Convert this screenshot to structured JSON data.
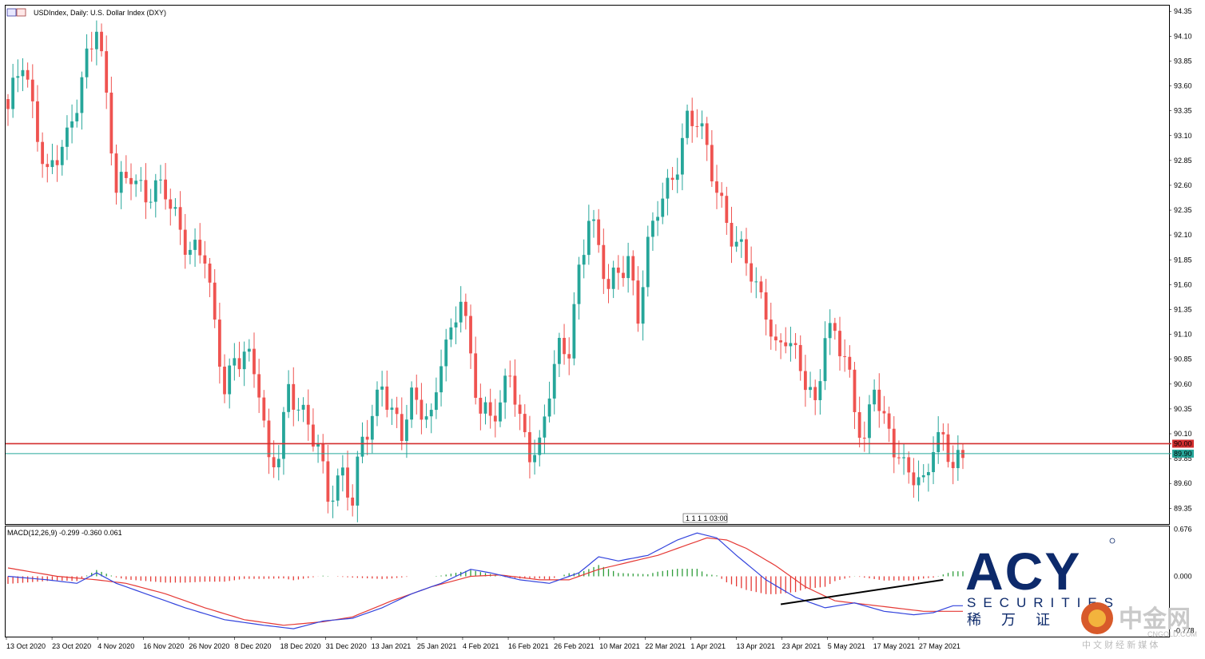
{
  "window": {
    "title": "USDIndex, Daily:  U.S. Dollar Index (DXY)"
  },
  "indicator": {
    "label": "MACD(12,26,9) -0.299 -0.360 0.061"
  },
  "price_tags": {
    "red_line_label": "90.00",
    "cyan_line_label": "89.90"
  },
  "period_separator_label": "1 1 1 1 03:00",
  "brand": {
    "name": "ACY",
    "tagline": "SECURITIES",
    "chinese": "稀 万 证",
    "watermark": "中金网",
    "watermark_url": "CNGOLD.COM",
    "watermark_cn": "中 文 财 经 新 媒 体"
  },
  "colors": {
    "bull": "#26a69a",
    "bear": "#ef5350",
    "red_line": "#d32f2f",
    "cyan_line": "#26a69a",
    "macd_line": "#3344dd",
    "signal_line": "#e53935",
    "hist_up": "#2e9d3a",
    "hist_down": "#e53935",
    "trend_line": "#000000"
  },
  "chart_data": [
    {
      "type": "candlestick",
      "title": "USDIndex, Daily:  U.S. Dollar Index (DXY)",
      "ylim": [
        89.2,
        94.4
      ],
      "y_ticks": [
        94.35,
        94.1,
        93.85,
        93.6,
        93.35,
        93.1,
        92.85,
        92.6,
        92.35,
        92.1,
        91.85,
        91.6,
        91.35,
        91.1,
        90.85,
        90.6,
        90.35,
        90.1,
        89.85,
        89.6,
        89.35
      ],
      "x_tick_labels": [
        "13 Oct 2020",
        "23 Oct 2020",
        "4 Nov 2020",
        "16 Nov 2020",
        "26 Nov 2020",
        "8 Dec 2020",
        "18 Dec 2020",
        "31 Dec 2020",
        "13 Jan 2021",
        "25 Jan 2021",
        "4 Feb 2021",
        "16 Feb 2021",
        "26 Feb 2021",
        "10 Mar 2021",
        "22 Mar 2021",
        "1 Apr 2021",
        "13 Apr 2021",
        "23 Apr 2021",
        "5 May 2021",
        "17 May 2021",
        "27 May 2021"
      ],
      "horizontal_lines": [
        {
          "value": 90.0,
          "label": "90.00",
          "color": "red"
        },
        {
          "value": 89.9,
          "label": "89.90",
          "color": "cyan"
        }
      ],
      "keypoints": [
        {
          "i": 0,
          "c": 93.3
        },
        {
          "i": 3,
          "c": 93.85
        },
        {
          "i": 6,
          "c": 93.2
        },
        {
          "i": 8,
          "c": 92.7
        },
        {
          "i": 12,
          "c": 93.0
        },
        {
          "i": 16,
          "c": 93.95
        },
        {
          "i": 18,
          "c": 94.25
        },
        {
          "i": 20,
          "c": 93.4
        },
        {
          "i": 22,
          "c": 92.5
        },
        {
          "i": 25,
          "c": 92.8
        },
        {
          "i": 28,
          "c": 92.5
        },
        {
          "i": 32,
          "c": 92.5
        },
        {
          "i": 34,
          "c": 92.3
        },
        {
          "i": 37,
          "c": 92.0
        },
        {
          "i": 40,
          "c": 91.85
        },
        {
          "i": 42,
          "c": 91.1
        },
        {
          "i": 44,
          "c": 90.6
        },
        {
          "i": 46,
          "c": 90.9
        },
        {
          "i": 48,
          "c": 90.95
        },
        {
          "i": 51,
          "c": 90.5
        },
        {
          "i": 53,
          "c": 89.75
        },
        {
          "i": 55,
          "c": 90.0
        },
        {
          "i": 57,
          "c": 90.6
        },
        {
          "i": 60,
          "c": 90.2
        },
        {
          "i": 63,
          "c": 89.95
        },
        {
          "i": 65,
          "c": 89.55
        },
        {
          "i": 68,
          "c": 89.7
        },
        {
          "i": 70,
          "c": 89.35
        },
        {
          "i": 72,
          "c": 90.0
        },
        {
          "i": 74,
          "c": 90.3
        },
        {
          "i": 76,
          "c": 90.7
        },
        {
          "i": 78,
          "c": 90.3
        },
        {
          "i": 80,
          "c": 90.05
        },
        {
          "i": 82,
          "c": 90.4
        },
        {
          "i": 84,
          "c": 90.4
        },
        {
          "i": 86,
          "c": 90.3
        },
        {
          "i": 88,
          "c": 90.9
        },
        {
          "i": 90,
          "c": 91.0
        },
        {
          "i": 92,
          "c": 91.45
        },
        {
          "i": 94,
          "c": 90.9
        },
        {
          "i": 96,
          "c": 90.4
        },
        {
          "i": 98,
          "c": 90.3
        },
        {
          "i": 100,
          "c": 90.3
        },
        {
          "i": 102,
          "c": 90.7
        },
        {
          "i": 104,
          "c": 90.25
        },
        {
          "i": 106,
          "c": 90.0
        },
        {
          "i": 108,
          "c": 89.95
        },
        {
          "i": 110,
          "c": 90.5
        },
        {
          "i": 112,
          "c": 90.9
        },
        {
          "i": 114,
          "c": 91.0
        },
        {
          "i": 116,
          "c": 91.8
        },
        {
          "i": 118,
          "c": 92.3
        },
        {
          "i": 120,
          "c": 91.9
        },
        {
          "i": 122,
          "c": 91.5
        },
        {
          "i": 124,
          "c": 91.8
        },
        {
          "i": 126,
          "c": 91.9
        },
        {
          "i": 128,
          "c": 91.3
        },
        {
          "i": 130,
          "c": 91.9
        },
        {
          "i": 132,
          "c": 92.35
        },
        {
          "i": 134,
          "c": 92.6
        },
        {
          "i": 136,
          "c": 92.9
        },
        {
          "i": 138,
          "c": 93.25
        },
        {
          "i": 140,
          "c": 93.2
        },
        {
          "i": 142,
          "c": 92.9
        },
        {
          "i": 144,
          "c": 92.6
        },
        {
          "i": 146,
          "c": 92.3
        },
        {
          "i": 148,
          "c": 92.0
        },
        {
          "i": 150,
          "c": 91.8
        },
        {
          "i": 152,
          "c": 91.5
        },
        {
          "i": 154,
          "c": 91.4
        },
        {
          "i": 156,
          "c": 91.0
        },
        {
          "i": 158,
          "c": 91.1
        },
        {
          "i": 160,
          "c": 90.8
        },
        {
          "i": 162,
          "c": 90.6
        },
        {
          "i": 164,
          "c": 90.4
        },
        {
          "i": 166,
          "c": 91.2
        },
        {
          "i": 168,
          "c": 91.1
        },
        {
          "i": 170,
          "c": 90.8
        },
        {
          "i": 172,
          "c": 90.3
        },
        {
          "i": 174,
          "c": 90.05
        },
        {
          "i": 176,
          "c": 90.7
        },
        {
          "i": 178,
          "c": 90.2
        },
        {
          "i": 180,
          "c": 89.9
        },
        {
          "i": 182,
          "c": 89.7
        },
        {
          "i": 184,
          "c": 89.75
        },
        {
          "i": 186,
          "c": 89.65
        },
        {
          "i": 188,
          "c": 90.0
        },
        {
          "i": 190,
          "c": 89.95
        },
        {
          "i": 192,
          "c": 89.75
        },
        {
          "i": 194,
          "c": 89.9
        }
      ]
    },
    {
      "type": "macd",
      "title": "MACD(12,26,9) -0.299 -0.360 0.061",
      "ylim": [
        -0.84,
        0.68
      ],
      "y_ticks": [
        0.676,
        0.0,
        -0.778
      ],
      "y_tick_labels": [
        "0.676",
        "0.000",
        "-0.778"
      ],
      "macd_line": [
        [
          0,
          0.0
        ],
        [
          8,
          -0.05
        ],
        [
          14,
          -0.1
        ],
        [
          18,
          0.05
        ],
        [
          22,
          -0.1
        ],
        [
          28,
          -0.25
        ],
        [
          36,
          -0.45
        ],
        [
          44,
          -0.62
        ],
        [
          52,
          -0.7
        ],
        [
          58,
          -0.75
        ],
        [
          64,
          -0.64
        ],
        [
          70,
          -0.6
        ],
        [
          76,
          -0.45
        ],
        [
          82,
          -0.25
        ],
        [
          88,
          -0.1
        ],
        [
          94,
          0.1
        ],
        [
          98,
          0.05
        ],
        [
          104,
          -0.05
        ],
        [
          110,
          -0.1
        ],
        [
          116,
          0.05
        ],
        [
          120,
          0.28
        ],
        [
          124,
          0.22
        ],
        [
          130,
          0.3
        ],
        [
          136,
          0.52
        ],
        [
          140,
          0.62
        ],
        [
          144,
          0.55
        ],
        [
          148,
          0.3
        ],
        [
          154,
          -0.05
        ],
        [
          160,
          -0.3
        ],
        [
          166,
          -0.45
        ],
        [
          172,
          -0.38
        ],
        [
          178,
          -0.5
        ],
        [
          184,
          -0.55
        ],
        [
          188,
          -0.52
        ],
        [
          192,
          -0.42
        ]
      ],
      "signal_line": [
        [
          0,
          0.12
        ],
        [
          10,
          0.0
        ],
        [
          18,
          -0.05
        ],
        [
          24,
          -0.1
        ],
        [
          32,
          -0.25
        ],
        [
          40,
          -0.45
        ],
        [
          48,
          -0.62
        ],
        [
          56,
          -0.7
        ],
        [
          64,
          -0.65
        ],
        [
          70,
          -0.58
        ],
        [
          78,
          -0.35
        ],
        [
          86,
          -0.15
        ],
        [
          94,
          0.0
        ],
        [
          100,
          0.02
        ],
        [
          108,
          -0.05
        ],
        [
          114,
          -0.05
        ],
        [
          120,
          0.1
        ],
        [
          126,
          0.2
        ],
        [
          132,
          0.3
        ],
        [
          138,
          0.45
        ],
        [
          142,
          0.55
        ],
        [
          146,
          0.52
        ],
        [
          150,
          0.4
        ],
        [
          156,
          0.15
        ],
        [
          162,
          -0.15
        ],
        [
          168,
          -0.35
        ],
        [
          174,
          -0.4
        ],
        [
          180,
          -0.45
        ],
        [
          186,
          -0.5
        ],
        [
          192,
          -0.5
        ]
      ],
      "trend_line": {
        "from": [
          157,
          -0.4
        ],
        "to": [
          190,
          -0.05
        ]
      }
    }
  ]
}
